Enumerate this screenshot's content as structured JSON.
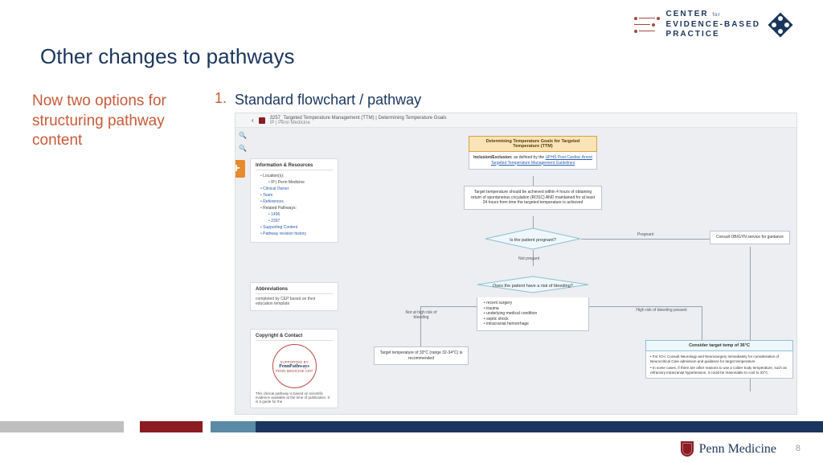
{
  "cep_logo": {
    "line1": "CENTER",
    "line1_sub": "for",
    "line2": "EVIDENCE-BASED",
    "line3": "PRACTICE"
  },
  "title": "Other changes to pathways",
  "subtitle": "Now two options for structuring pathway content",
  "list": {
    "number": "1.",
    "text": "Standard flowchart / pathway"
  },
  "screenshot": {
    "doc_title": "3257_Targeted Temperature Management (TTM) | Determining Temperature Goals",
    "doc_subtitle": "IP | Penn Medicine",
    "panels": {
      "info": {
        "header": "Information & Resources",
        "loc_label": "Location(s):",
        "loc_value": "IP | Penn Medicine",
        "items": [
          "Clinical Owner",
          "Team",
          "References"
        ],
        "related_label": "Related Pathways:",
        "related": [
          "1496",
          "2397"
        ],
        "tail": [
          "Supporting Content",
          "Pathway revision history"
        ]
      },
      "abbr": {
        "header": "Abbreviations",
        "body": "completed by CEP based on their education template"
      },
      "copy": {
        "header": "Copyright & Contact",
        "stamp_top": "SUPPORTED BY",
        "stamp_brand": "PennPathways",
        "stamp_bottom": "PENN MEDICINE CEP",
        "body": "This clinical pathway is based on scientific evidence available at the time of publication. It is a guide for the"
      }
    },
    "flow": {
      "n_title": "Determining Temperature Goals for Targeted Temperature (TTM)",
      "n_incl_label": "Inclusion/Exclusion:",
      "n_incl_text": "as defined by the ",
      "n_incl_link": "UPHS Post Cardiac Arrest Targeted Temperature Management Guidelines",
      "n_target": "Target temperature should be achieved within 4 hours of obtaining return of spontaneous circulation (ROSC) AND maintained for at least 24 hours from time the targeted temperature is achieved",
      "d_preg": "Is the patient pregnant?",
      "lbl_preg_yes": "Pregnant",
      "lbl_preg_no": "Not pregant",
      "n_obgyn": "Consult OB/GYN service for guidance",
      "d_bleed": "Does the patient have a risk of bleeding?",
      "bleed_items": [
        "recent surgery",
        "trauma",
        "underlying medical condition",
        "septic shock",
        "intracranial hemorrhage"
      ],
      "lbl_bleed_no": "Not at high risk of bleeding",
      "lbl_bleed_yes": "High risk of bleeding present",
      "n_33": "Target temperature of 33°C (range 32-34°C) is recommended",
      "n_36_title": "Consider target temp of 36°C",
      "n_36_items": [
        "For ICH: Consult Neurology and Neurosurgery immediately for consideration of Neurocritical Care admission and guidance for target temperature",
        "In some cases, if there are other reasons to use a colder body temperature, such as refractory intracranial hypertension, it could be reasonable to cool to 33°C"
      ]
    }
  },
  "footer": {
    "brand": "Penn Medicine",
    "page": "8"
  }
}
